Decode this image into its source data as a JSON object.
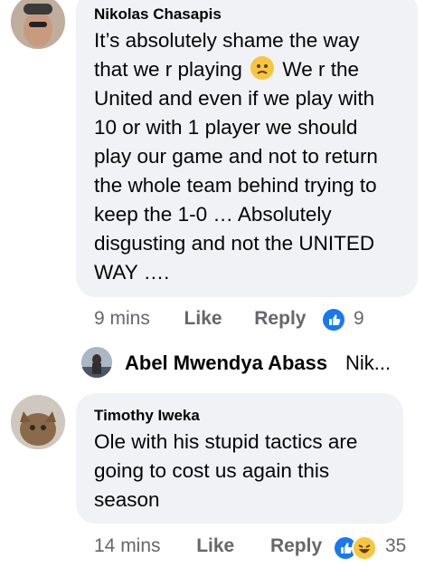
{
  "comments": [
    {
      "author": "Nikolas Chasapis",
      "lines": [
        "It’s absolutely shame the way",
        "that we r playing",
        "We r the",
        "United and even if we play with",
        "10 or with 1 player we should",
        "play our game and not to return",
        "the whole team behind trying to",
        "keep the 1-0 … Absolutely",
        "disgusting and not the UNITED",
        "WAY …."
      ],
      "inline_emoji": "worried-face-emoji",
      "time": "9 mins",
      "like_label": "Like",
      "reply_label": "Reply",
      "reaction_count": "9"
    },
    {
      "author": "Timothy Iweka",
      "lines": [
        "Ole with his stupid tactics are",
        "going to cost us again this",
        "season"
      ],
      "time": "14 mins",
      "like_label": "Like",
      "reply_label": "Reply",
      "reaction_count": "35"
    }
  ],
  "reply_preview": {
    "name": "Abel Mwendya Abass",
    "text": "Nik..."
  },
  "colors": {
    "bubble": "#f0f2f5",
    "meta_text": "#65676b",
    "like_blue": "#1877f2",
    "haha_yellow": "#f7c53f"
  }
}
